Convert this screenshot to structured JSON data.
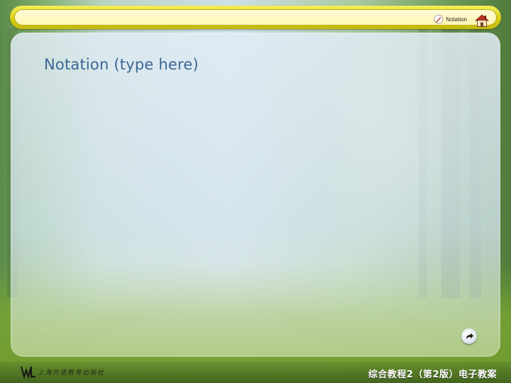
{
  "header": {
    "nav_notation_label": "Notation"
  },
  "main": {
    "title": "Notation (type here)"
  },
  "footer": {
    "publisher_name": "上海外语教育出版社",
    "course_title": "综合教程2（第2版）电子教案"
  },
  "colors": {
    "banner_yellow": "#d9cf16",
    "title_blue": "#3b6794",
    "footer_text": "#ffffff"
  },
  "icons": {
    "nav_notation": "pen-icon",
    "home": "home-icon",
    "next": "arrow-right-icon",
    "publisher": "wl-logo"
  }
}
